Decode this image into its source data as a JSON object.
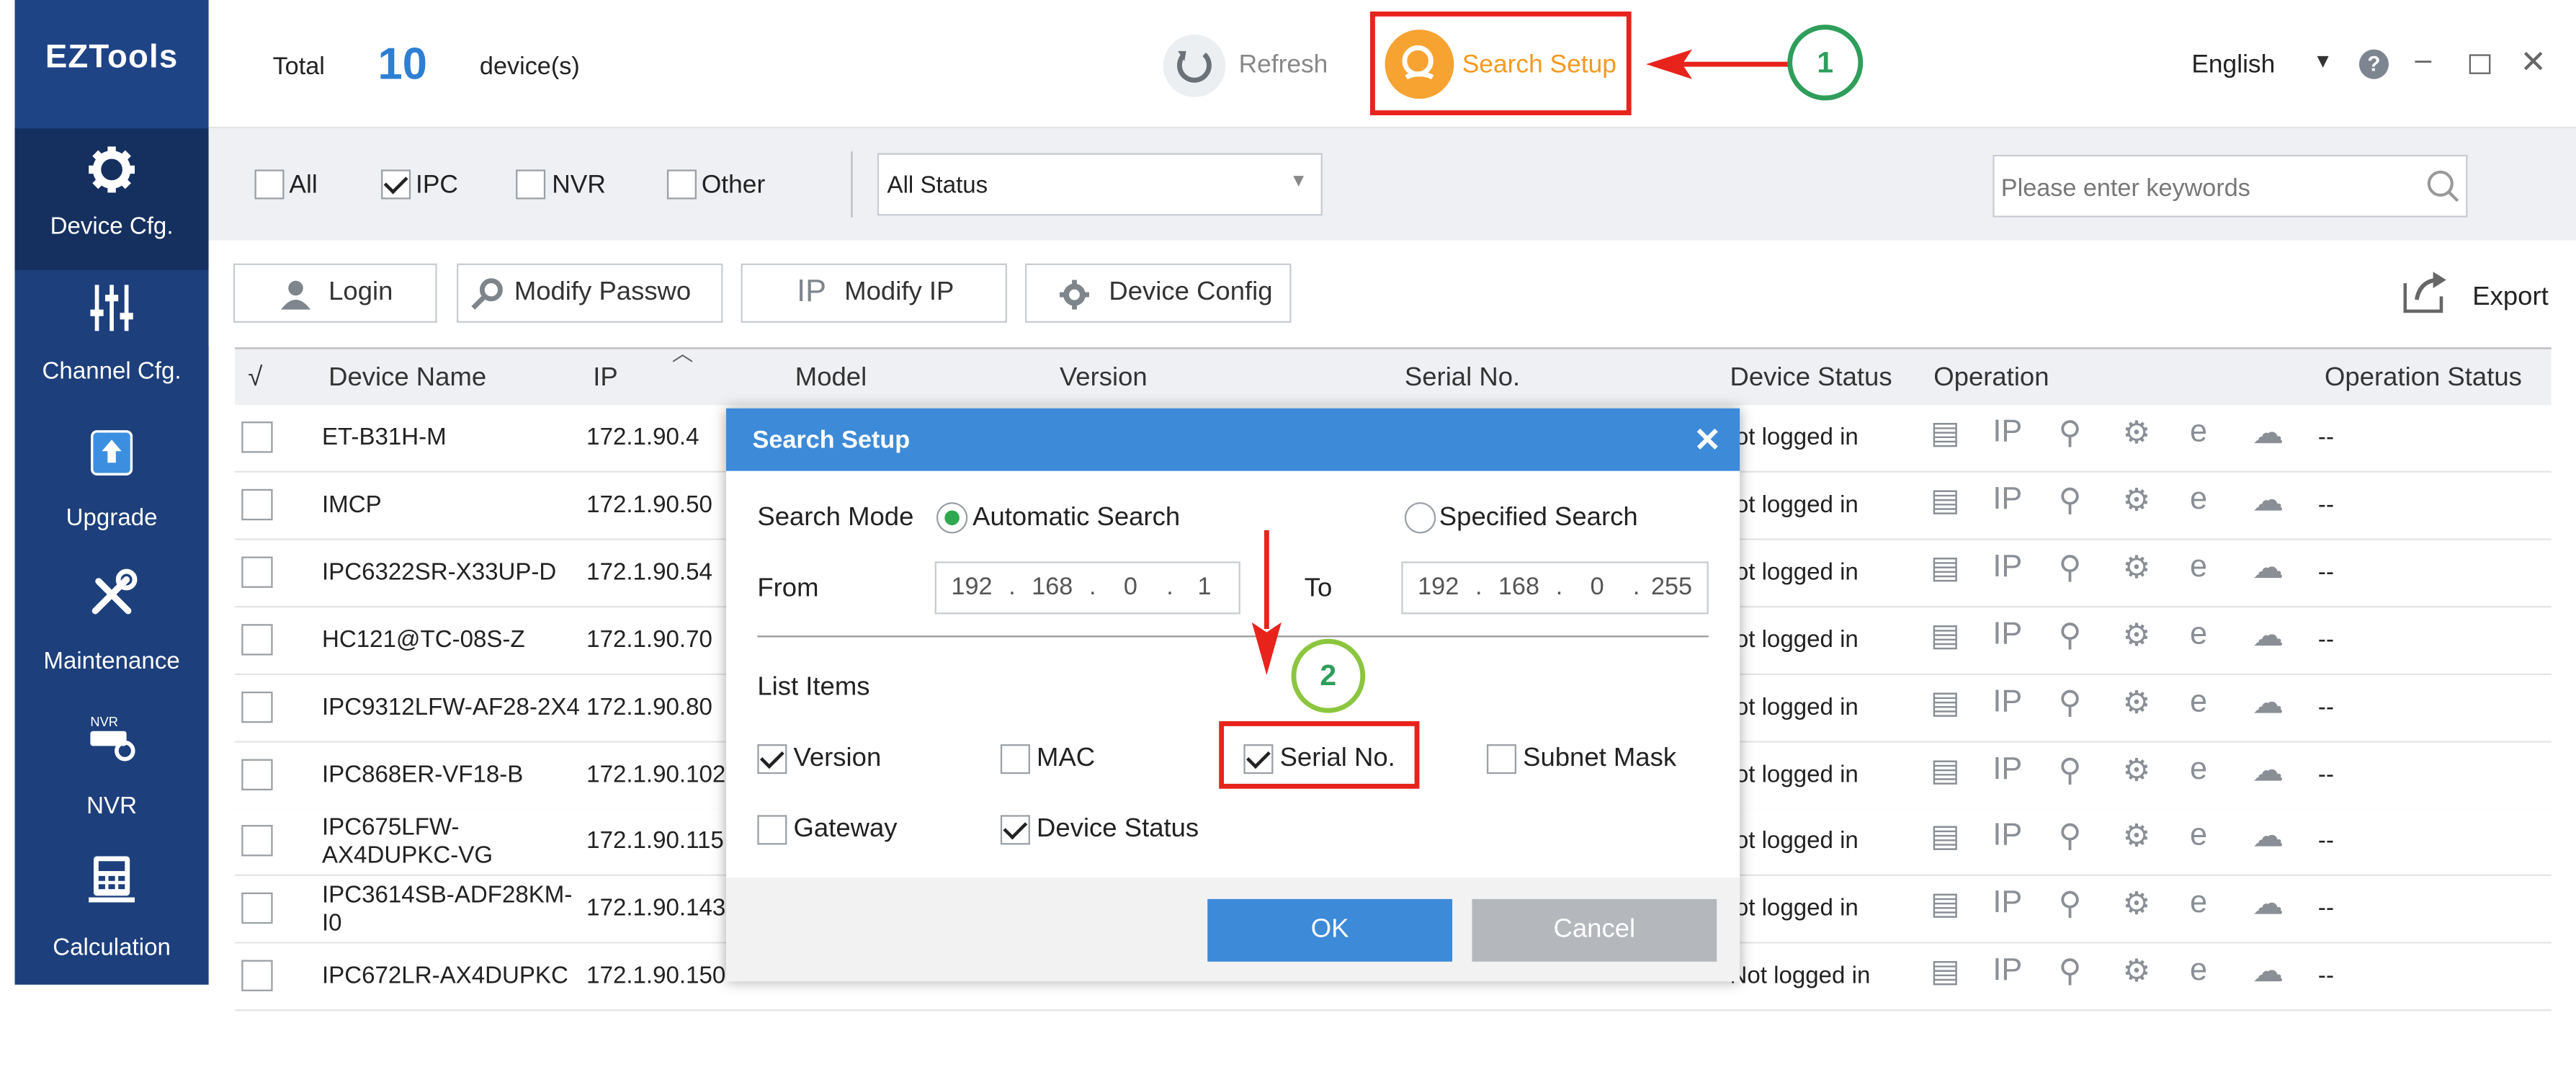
{
  "app": {
    "logo": "EZTools"
  },
  "sidebar": {
    "items": [
      {
        "label": "Device Cfg.",
        "icon": "gear-icon"
      },
      {
        "label": "Channel Cfg.",
        "icon": "sliders-icon"
      },
      {
        "label": "Upgrade",
        "icon": "upgrade-icon"
      },
      {
        "label": "Maintenance",
        "icon": "tools-icon"
      },
      {
        "label": "NVR",
        "icon": "nvr-icon"
      },
      {
        "label": "Calculation",
        "icon": "calculator-icon"
      }
    ]
  },
  "header": {
    "total_label": "Total",
    "total_count": "10",
    "total_unit": "device(s)",
    "refresh_label": "Refresh",
    "search_setup_label": "Search Setup",
    "language": "English",
    "callout_1": "1"
  },
  "filter": {
    "all_label": "All",
    "ipc_label": "IPC",
    "nvr_label": "NVR",
    "other_label": "Other",
    "status_value": "All Status",
    "search_placeholder": "Please enter keywords"
  },
  "actions": {
    "login": "Login",
    "modify_password": "Modify Passwo",
    "modify_ip_icon": "IP",
    "modify_ip": "Modify IP",
    "device_config": "Device Config",
    "export": "Export"
  },
  "table": {
    "columns": {
      "check": "√",
      "name": "Device Name",
      "ip": "IP",
      "model": "Model",
      "version": "Version",
      "serial": "Serial No.",
      "status": "Device Status",
      "operation": "Operation",
      "op_status": "Operation Status"
    },
    "rows": [
      {
        "name": "ET-B31H-M",
        "ip": "172.1.90.4",
        "status": "lot logged in",
        "op_status": "--"
      },
      {
        "name": "IMCP",
        "ip": "172.1.90.50",
        "status": "lot logged in",
        "op_status": "--"
      },
      {
        "name": "IPC6322SR-X33UP-D",
        "ip": "172.1.90.54",
        "status": "lot logged in",
        "op_status": "--"
      },
      {
        "name": "HC121@TC-08S-Z",
        "ip": "172.1.90.70",
        "status": "lot logged in",
        "op_status": "--"
      },
      {
        "name": "IPC9312LFW-AF28-2X4",
        "ip": "172.1.90.80",
        "status": "lot logged in",
        "op_status": "--"
      },
      {
        "name": "IPC868ER-VF18-B",
        "ip": "172.1.90.102",
        "status": "lot logged in",
        "op_status": "--"
      },
      {
        "name": "IPC675LFW-\nAX4DUPKC-VG",
        "ip": "172.1.90.115",
        "status": "lot logged in",
        "op_status": "--"
      },
      {
        "name": "IPC3614SB-ADF28KM-\nI0",
        "ip": "172.1.90.143",
        "status": "lot logged in",
        "op_status": "--"
      },
      {
        "name": "IPC672LR-AX4DUPKC",
        "ip": "172.1.90.150",
        "status": "Not logged in",
        "op_status": "--"
      }
    ]
  },
  "dialog": {
    "title": "Search Setup",
    "search_mode_label": "Search Mode",
    "automatic": "Automatic Search",
    "specified": "Specified Search",
    "from_label": "From",
    "to_label": "To",
    "from_ip": [
      "192",
      "168",
      "0",
      "1"
    ],
    "to_ip": [
      "192",
      "168",
      "0",
      "255"
    ],
    "list_items_label": "List Items",
    "version": "Version",
    "mac": "MAC",
    "serial": "Serial No.",
    "subnet": "Subnet Mask",
    "gateway": "Gateway",
    "device_status": "Device Status",
    "ok": "OK",
    "cancel": "Cancel",
    "callout_2": "2"
  },
  "colors": {
    "sidebar": "#1d3f7c",
    "accent_blue": "#3d8ad8",
    "highlight_red": "#e8231c",
    "search_orange": "#f7a332",
    "callout_green": "#2e9e5a"
  }
}
